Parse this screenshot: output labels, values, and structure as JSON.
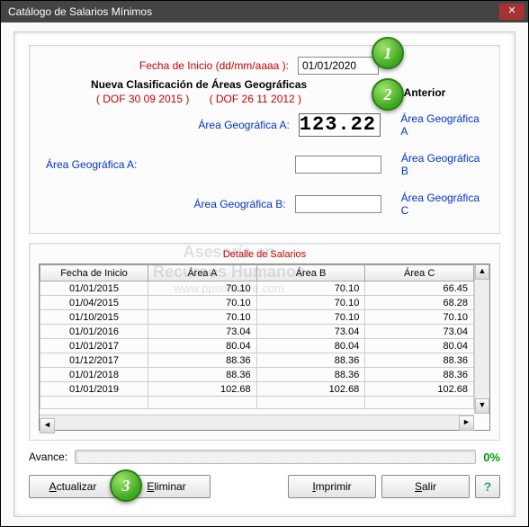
{
  "window": {
    "title": "Catálogo de Salarios Mínimos"
  },
  "form": {
    "fecha_label": "Fecha de Inicio (dd/mm/aaaa ):",
    "fecha_value": "01/01/2020",
    "nueva_clasif": "Nueva Clasificación de Áreas Geográficas",
    "dof1": "( DOF 30 09 2015 )",
    "dof2": "( DOF 26 11 2012 )",
    "anterior": "Anterior",
    "area_a_left": "Área Geográfica A:",
    "area_a_mid": "Área Geográfica A:",
    "area_b_mid": "Área Geográfica B:",
    "valor_principal": "123.22",
    "ant_a": "Área Geográfica A",
    "ant_b": "Área Geográfica B",
    "ant_c": "Área Geográfica C"
  },
  "detalle": {
    "title": "Detalle de Salarios",
    "headers": {
      "fecha": "Fecha de Inicio",
      "a": "Área A",
      "b": "Área B",
      "c": "Área C"
    },
    "rows": [
      {
        "fecha": "01/01/2015",
        "a": "70.10",
        "b": "70.10",
        "c": "66.45"
      },
      {
        "fecha": "01/04/2015",
        "a": "70.10",
        "b": "70.10",
        "c": "68.28"
      },
      {
        "fecha": "01/10/2015",
        "a": "70.10",
        "b": "70.10",
        "c": "70.10"
      },
      {
        "fecha": "01/01/2016",
        "a": "73.04",
        "b": "73.04",
        "c": "73.04"
      },
      {
        "fecha": "01/01/2017",
        "a": "80.04",
        "b": "80.04",
        "c": "80.04"
      },
      {
        "fecha": "01/12/2017",
        "a": "88.36",
        "b": "88.36",
        "c": "88.36"
      },
      {
        "fecha": "01/01/2018",
        "a": "88.36",
        "b": "88.36",
        "c": "88.36"
      },
      {
        "fecha": "01/01/2019",
        "a": "102.68",
        "b": "102.68",
        "c": "102.68"
      }
    ]
  },
  "progress": {
    "label": "Avance:",
    "percent": "0%"
  },
  "buttons": {
    "actualizar": "Actualizar",
    "eliminar": "Eliminar",
    "imprimir": "Imprimir",
    "salir": "Salir",
    "help": "?"
  },
  "callouts": {
    "c1": "1",
    "c2": "2",
    "c3": "3"
  },
  "watermark": {
    "line1": "Asesoría en",
    "line2": "Recursos Humanos",
    "line3": "www.ppsoftware.com"
  }
}
